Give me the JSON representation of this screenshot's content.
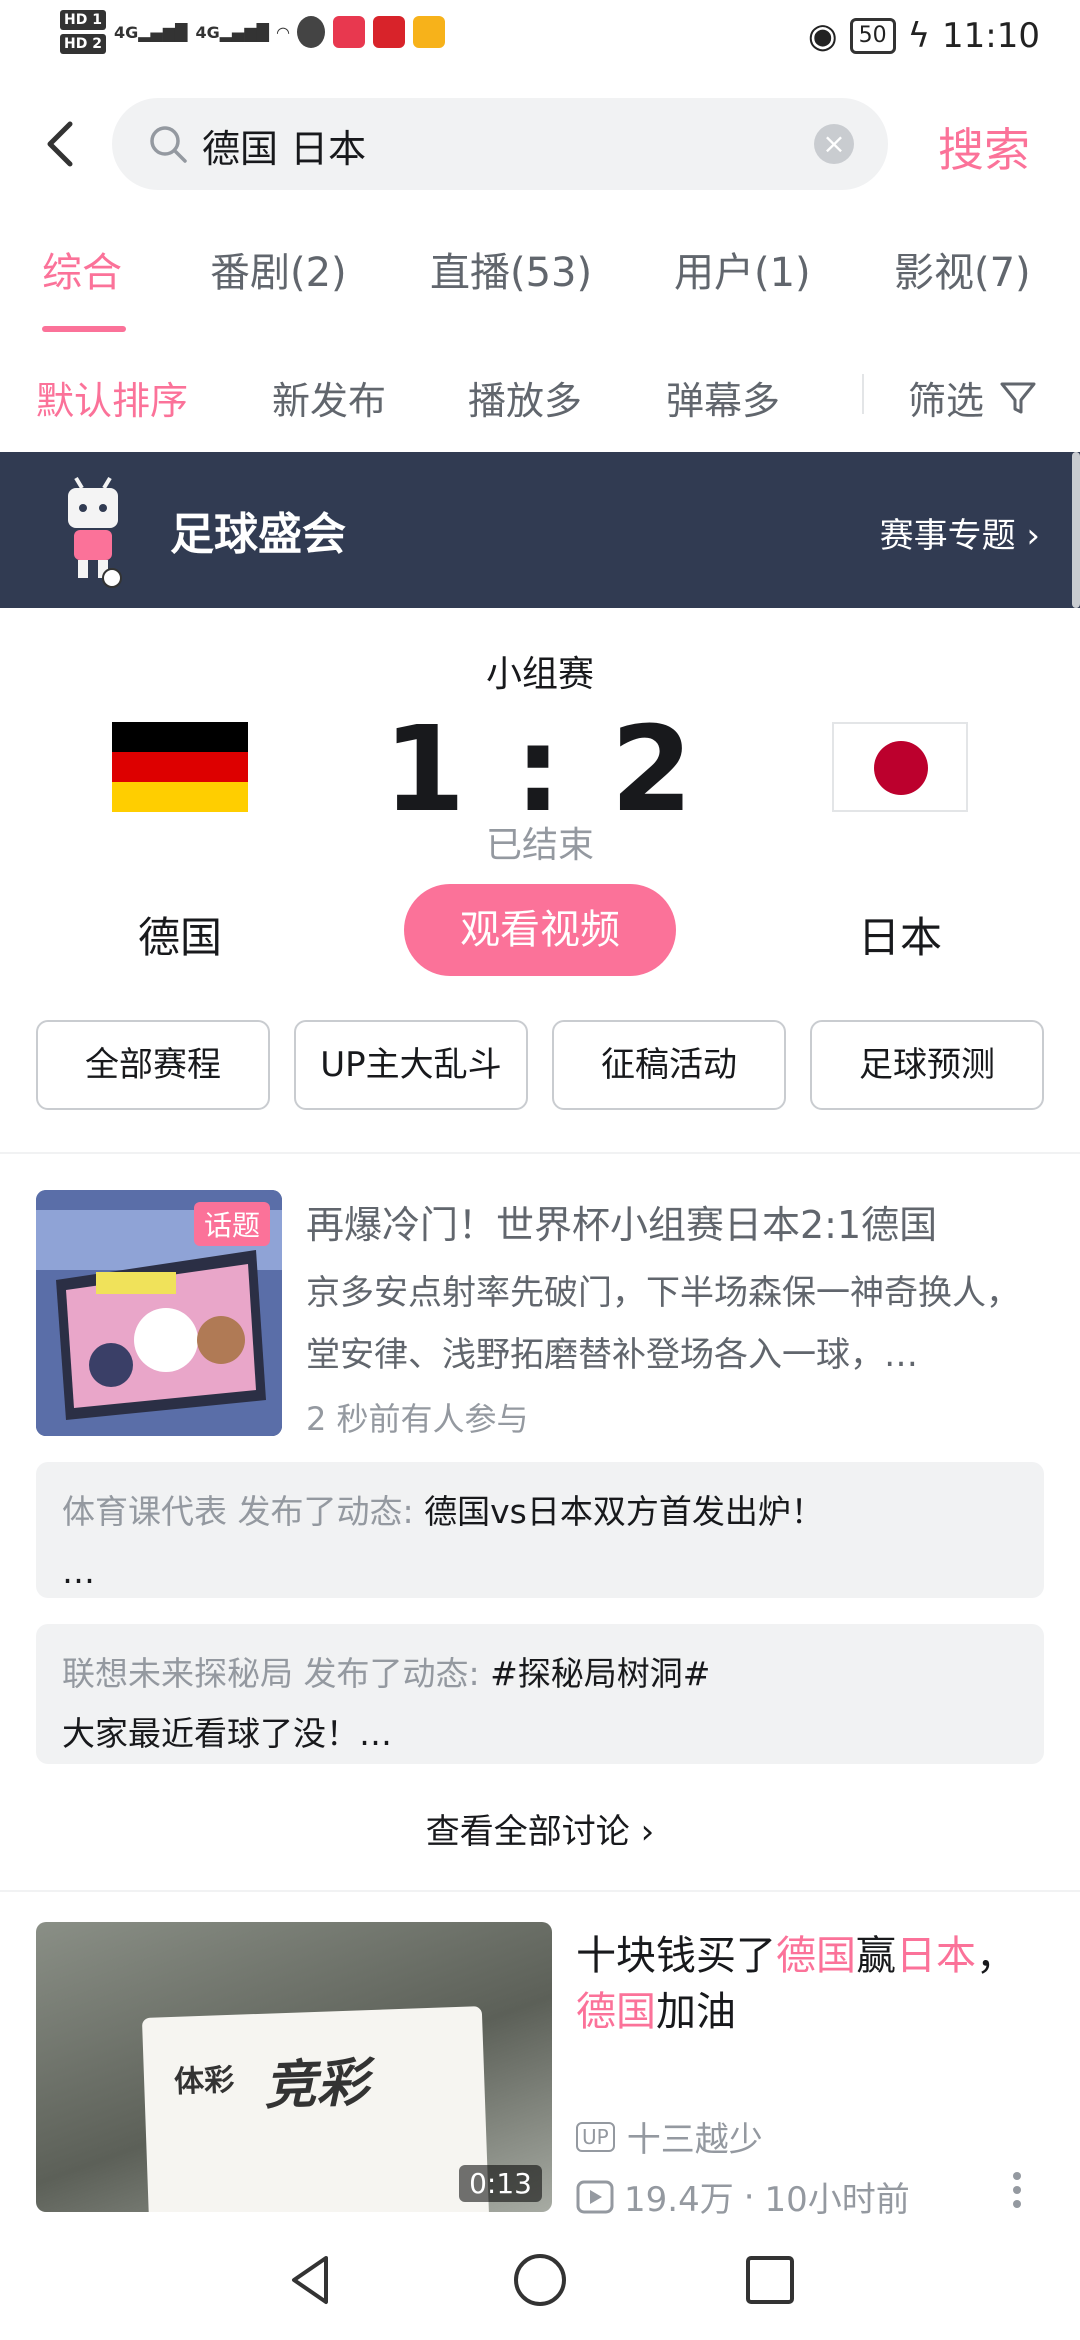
{
  "status_bar": {
    "time": "11:10",
    "battery": "50",
    "hd1": "HD 1",
    "hd2": "HD 2",
    "sig1": "4G",
    "sig2": "4G"
  },
  "search": {
    "query": "德国 日本",
    "submit_label": "搜索"
  },
  "tabs": [
    {
      "label": "综合",
      "active": true
    },
    {
      "label": "番剧(2)",
      "active": false
    },
    {
      "label": "直播(53)",
      "active": false
    },
    {
      "label": "用户(1)",
      "active": false
    },
    {
      "label": "影视(7)",
      "active": false
    }
  ],
  "sort": {
    "options": [
      "默认排序",
      "新发布",
      "播放多",
      "弹幕多"
    ],
    "filter_label": "筛选"
  },
  "banner": {
    "title": "足球盛会",
    "link_label": "赛事专题"
  },
  "match": {
    "stage": "小组赛",
    "score": "1 : 2",
    "status": "已结束",
    "home_team": "德国",
    "away_team": "日本",
    "watch_label": "观看视频"
  },
  "chips": [
    "全部赛程",
    "UP主大乱斗",
    "征稿活动",
    "足球预测"
  ],
  "topic": {
    "badge": "话题",
    "title": "再爆冷门！世界杯小组赛日本2:1德国",
    "description": "京多安点射率先破门，下半场森保一神奇换人，堂安律、浅野拓磨替补登场各入一球，…",
    "meta": "2 秒前有人参与"
  },
  "posts": [
    {
      "author": "体育课代表 发布了动态:",
      "content": "德国vs日本双方首发出炉！",
      "content2": "…"
    },
    {
      "author": "联想未来探秘局 发布了动态:",
      "content": "#探秘局树洞#",
      "content2": "大家最近看球了没！…"
    }
  ],
  "see_all_label": "查看全部讨论",
  "video": {
    "title_parts": [
      "十块钱买了",
      "德国",
      "赢",
      "日本",
      "，",
      "德国",
      "加油"
    ],
    "duration": "0:13",
    "up_tag": "UP",
    "uploader": "十三越少",
    "views": "19.4万",
    "dot": "·",
    "time": "10小时前",
    "receipt_text": "体彩",
    "receipt_brand": "竞彩"
  },
  "colors": {
    "accent": "#fb7299",
    "banner_bg": "#313b52",
    "muted": "#9499a0"
  }
}
